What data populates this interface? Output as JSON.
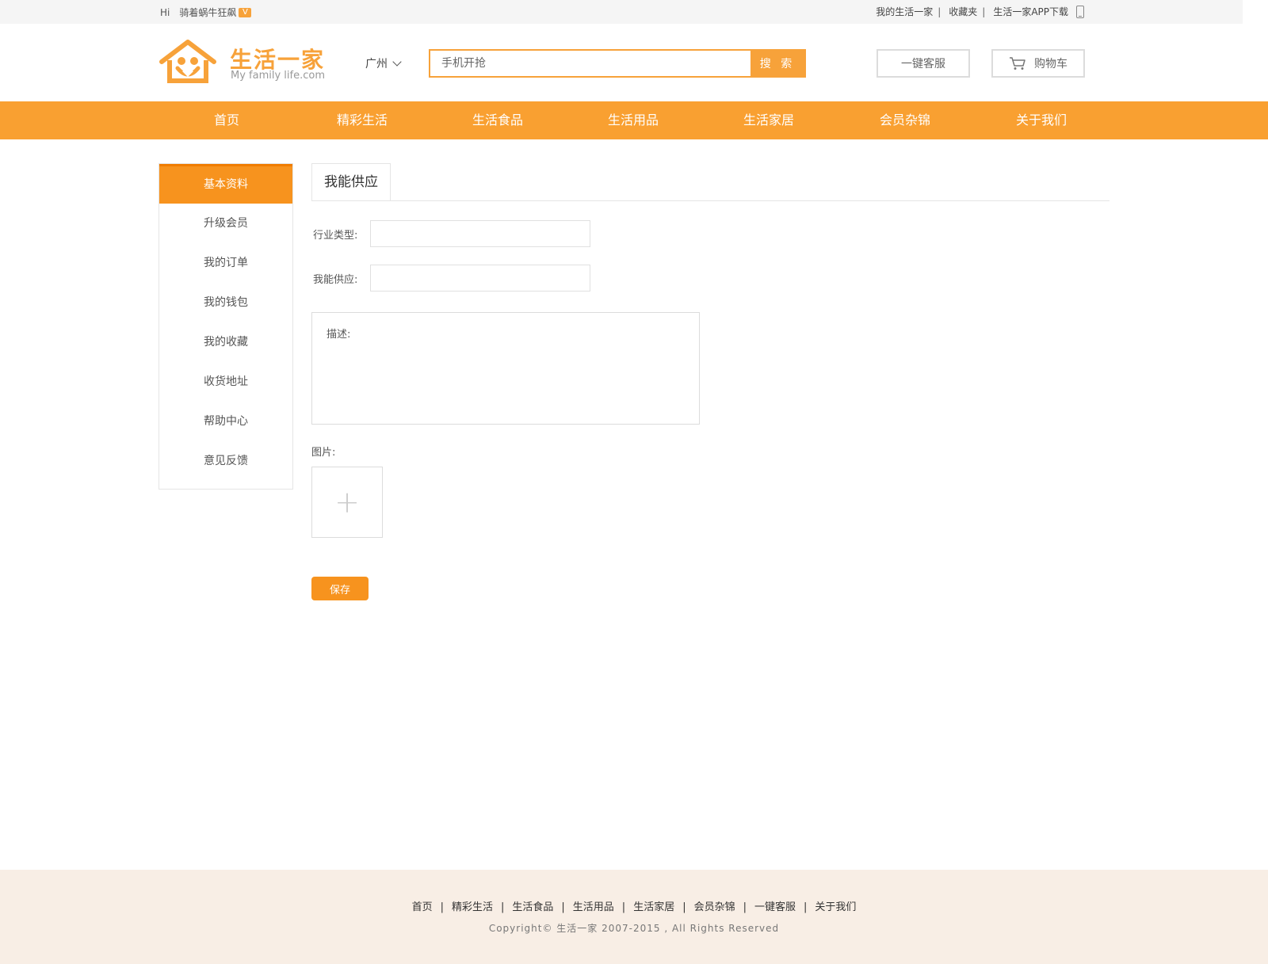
{
  "topbar": {
    "greeting": "Hi",
    "username": "骑着蜗牛狂飙",
    "vip_badge": "V",
    "links": [
      "我的生活一家",
      "收藏夹",
      "生活一家APP下载"
    ],
    "separator": "|"
  },
  "header": {
    "logo_title": "生活一家",
    "logo_subtitle": "My family life.com",
    "city": "广州",
    "search_placeholder": "手机开抢",
    "search_button": "搜 索",
    "service_button": "一键客服",
    "cart_button": "购物车"
  },
  "nav": {
    "items": [
      "首页",
      "精彩生活",
      "生活食品",
      "生活用品",
      "生活家居",
      "会员杂锦",
      "关于我们"
    ]
  },
  "sidebar": {
    "items": [
      "基本资料",
      "升级会员",
      "我的订单",
      "我的钱包",
      "我的收藏",
      "收货地址",
      "帮助中心",
      "意见反馈"
    ],
    "active_index": 0
  },
  "main": {
    "tab_title": "我能供应",
    "industry_label": "行业类型:",
    "supply_label": "我能供应:",
    "description_label": "描述:",
    "picture_label": "图片:",
    "upload_symbol": "+",
    "save_button": "保存"
  },
  "footer": {
    "links": [
      "首页",
      "精彩生活",
      "生活食品",
      "生活用品",
      "生活家居",
      "会员杂锦",
      "一键客服",
      "关于我们"
    ],
    "separator": "|",
    "copyright": "Copyright© 生活一家 2007-2015 , All Rights Reserved"
  },
  "colors": {
    "accent": "#f7a23a",
    "nav_bg": "#f9a031",
    "footer_bg": "#f8eee5"
  }
}
